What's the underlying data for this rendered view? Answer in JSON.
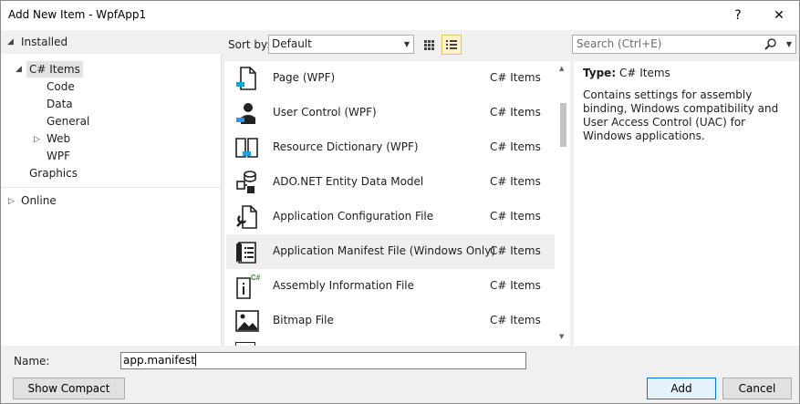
{
  "window": {
    "title": "Add New Item - WpfApp1",
    "help_glyph": "?",
    "close_glyph": "✕"
  },
  "tree": {
    "installed": "Installed",
    "csharp_items": "C# Items",
    "code": "Code",
    "data": "Data",
    "general": "General",
    "web": "Web",
    "wpf": "WPF",
    "graphics": "Graphics",
    "online": "Online"
  },
  "toolbar": {
    "sort_label": "Sort by:",
    "sort_value": "Default",
    "search_placeholder": "Search (Ctrl+E)"
  },
  "items": [
    {
      "name": "Page (WPF)",
      "category": "C# Items",
      "icon": "page-wpf-icon"
    },
    {
      "name": "User Control (WPF)",
      "category": "C# Items",
      "icon": "user-control-icon"
    },
    {
      "name": "Resource Dictionary (WPF)",
      "category": "C# Items",
      "icon": "resource-dictionary-icon"
    },
    {
      "name": "ADO.NET Entity Data Model",
      "category": "C# Items",
      "icon": "entity-model-icon"
    },
    {
      "name": "Application Configuration File",
      "category": "C# Items",
      "icon": "config-file-icon"
    },
    {
      "name": "Application Manifest File (Windows Only)",
      "category": "C# Items",
      "icon": "manifest-file-icon"
    },
    {
      "name": "Assembly Information File",
      "category": "C# Items",
      "icon": "assembly-info-icon"
    },
    {
      "name": "Bitmap File",
      "category": "C# Items",
      "icon": "bitmap-file-icon"
    }
  ],
  "details": {
    "type_label": "Type:",
    "type_value": "C# Items",
    "description": "Contains settings for assembly binding, Windows compatibility and User Access Control (UAC) for Windows applications."
  },
  "bottom": {
    "name_label": "Name:",
    "name_value": "app.manifest",
    "compact_view": "Show Compact View",
    "add": "Add",
    "cancel": "Cancel"
  },
  "colors": {
    "accent": "#0078d7",
    "selection": "#e3e3e3",
    "active_view": "#fff3c8"
  }
}
